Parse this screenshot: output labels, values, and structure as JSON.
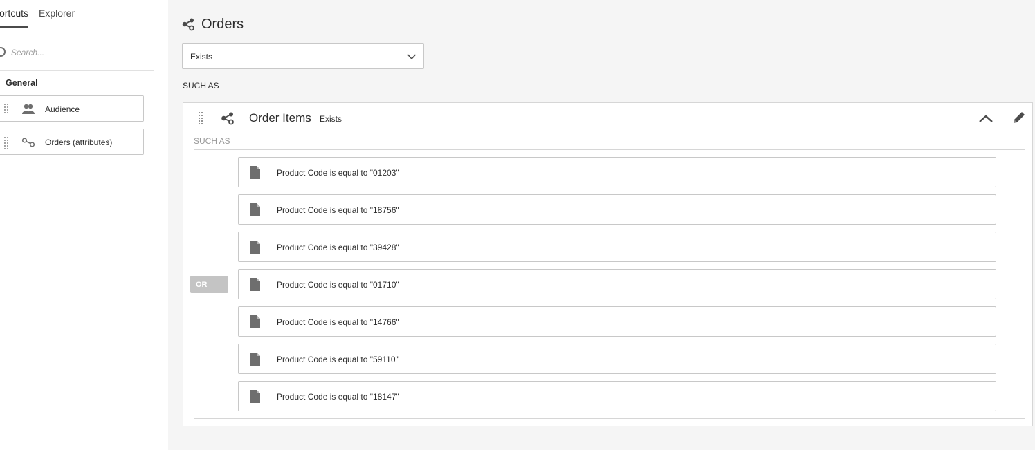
{
  "left_panel": {
    "tabs": [
      {
        "label": "Shortcuts",
        "active": true
      },
      {
        "label": "Explorer",
        "active": false
      }
    ],
    "search": {
      "placeholder": "Search..."
    },
    "group_title": "General",
    "shortcuts": [
      {
        "label": "Audience",
        "icon": "audience-icon"
      },
      {
        "label": "Orders (attributes)",
        "icon": "link-icon"
      }
    ]
  },
  "main": {
    "title": "Orders",
    "title_icon": "share-icon",
    "operator_select": {
      "value": "Exists"
    },
    "such_as_label": "SUCH AS",
    "card": {
      "title": "Order Items",
      "operator": "Exists",
      "such_as_label": "SUCH AS",
      "combinator": "OR",
      "conditions": [
        {
          "text": "Product Code  is equal to \"01203\""
        },
        {
          "text": "Product Code  is equal to \"18756\""
        },
        {
          "text": "Product Code  is equal to \"39428\""
        },
        {
          "text": "Product Code  is equal to \"01710\""
        },
        {
          "text": "Product Code  is equal to \"14766\""
        },
        {
          "text": "Product Code  is equal to \"59110\""
        },
        {
          "text": "Product Code  is equal to \"18147\""
        }
      ]
    }
  },
  "colors": {
    "panel_bg": "#ffffff",
    "main_bg": "#f5f5f5",
    "border": "#c8c8c8",
    "or_badge": "#c4c4c4",
    "text": "#2c2c2c",
    "muted_text": "#9a9a9a"
  }
}
